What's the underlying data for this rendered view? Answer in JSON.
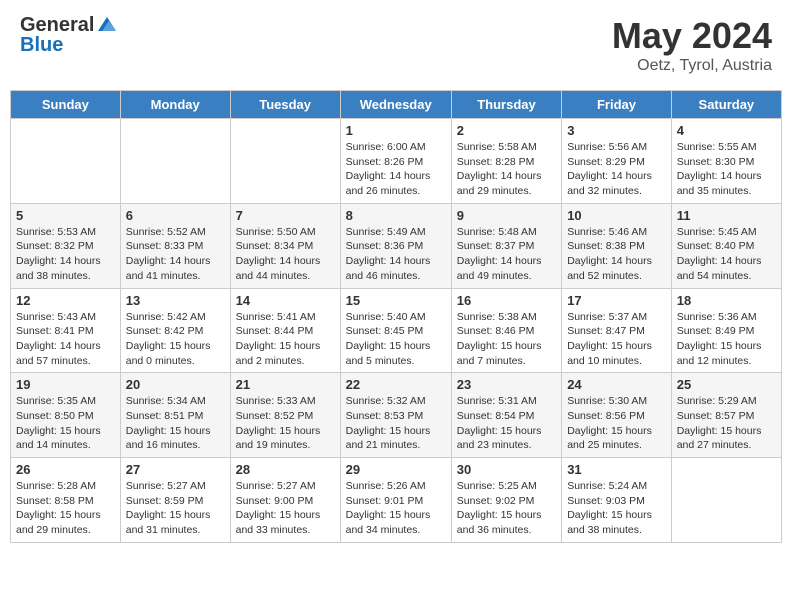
{
  "header": {
    "logo_general": "General",
    "logo_blue": "Blue",
    "month_year": "May 2024",
    "location": "Oetz, Tyrol, Austria"
  },
  "calendar": {
    "days_of_week": [
      "Sunday",
      "Monday",
      "Tuesday",
      "Wednesday",
      "Thursday",
      "Friday",
      "Saturday"
    ],
    "weeks": [
      [
        {
          "day": "",
          "info": ""
        },
        {
          "day": "",
          "info": ""
        },
        {
          "day": "",
          "info": ""
        },
        {
          "day": "1",
          "info": "Sunrise: 6:00 AM\nSunset: 8:26 PM\nDaylight: 14 hours\nand 26 minutes."
        },
        {
          "day": "2",
          "info": "Sunrise: 5:58 AM\nSunset: 8:28 PM\nDaylight: 14 hours\nand 29 minutes."
        },
        {
          "day": "3",
          "info": "Sunrise: 5:56 AM\nSunset: 8:29 PM\nDaylight: 14 hours\nand 32 minutes."
        },
        {
          "day": "4",
          "info": "Sunrise: 5:55 AM\nSunset: 8:30 PM\nDaylight: 14 hours\nand 35 minutes."
        }
      ],
      [
        {
          "day": "5",
          "info": "Sunrise: 5:53 AM\nSunset: 8:32 PM\nDaylight: 14 hours\nand 38 minutes."
        },
        {
          "day": "6",
          "info": "Sunrise: 5:52 AM\nSunset: 8:33 PM\nDaylight: 14 hours\nand 41 minutes."
        },
        {
          "day": "7",
          "info": "Sunrise: 5:50 AM\nSunset: 8:34 PM\nDaylight: 14 hours\nand 44 minutes."
        },
        {
          "day": "8",
          "info": "Sunrise: 5:49 AM\nSunset: 8:36 PM\nDaylight: 14 hours\nand 46 minutes."
        },
        {
          "day": "9",
          "info": "Sunrise: 5:48 AM\nSunset: 8:37 PM\nDaylight: 14 hours\nand 49 minutes."
        },
        {
          "day": "10",
          "info": "Sunrise: 5:46 AM\nSunset: 8:38 PM\nDaylight: 14 hours\nand 52 minutes."
        },
        {
          "day": "11",
          "info": "Sunrise: 5:45 AM\nSunset: 8:40 PM\nDaylight: 14 hours\nand 54 minutes."
        }
      ],
      [
        {
          "day": "12",
          "info": "Sunrise: 5:43 AM\nSunset: 8:41 PM\nDaylight: 14 hours\nand 57 minutes."
        },
        {
          "day": "13",
          "info": "Sunrise: 5:42 AM\nSunset: 8:42 PM\nDaylight: 15 hours\nand 0 minutes."
        },
        {
          "day": "14",
          "info": "Sunrise: 5:41 AM\nSunset: 8:44 PM\nDaylight: 15 hours\nand 2 minutes."
        },
        {
          "day": "15",
          "info": "Sunrise: 5:40 AM\nSunset: 8:45 PM\nDaylight: 15 hours\nand 5 minutes."
        },
        {
          "day": "16",
          "info": "Sunrise: 5:38 AM\nSunset: 8:46 PM\nDaylight: 15 hours\nand 7 minutes."
        },
        {
          "day": "17",
          "info": "Sunrise: 5:37 AM\nSunset: 8:47 PM\nDaylight: 15 hours\nand 10 minutes."
        },
        {
          "day": "18",
          "info": "Sunrise: 5:36 AM\nSunset: 8:49 PM\nDaylight: 15 hours\nand 12 minutes."
        }
      ],
      [
        {
          "day": "19",
          "info": "Sunrise: 5:35 AM\nSunset: 8:50 PM\nDaylight: 15 hours\nand 14 minutes."
        },
        {
          "day": "20",
          "info": "Sunrise: 5:34 AM\nSunset: 8:51 PM\nDaylight: 15 hours\nand 16 minutes."
        },
        {
          "day": "21",
          "info": "Sunrise: 5:33 AM\nSunset: 8:52 PM\nDaylight: 15 hours\nand 19 minutes."
        },
        {
          "day": "22",
          "info": "Sunrise: 5:32 AM\nSunset: 8:53 PM\nDaylight: 15 hours\nand 21 minutes."
        },
        {
          "day": "23",
          "info": "Sunrise: 5:31 AM\nSunset: 8:54 PM\nDaylight: 15 hours\nand 23 minutes."
        },
        {
          "day": "24",
          "info": "Sunrise: 5:30 AM\nSunset: 8:56 PM\nDaylight: 15 hours\nand 25 minutes."
        },
        {
          "day": "25",
          "info": "Sunrise: 5:29 AM\nSunset: 8:57 PM\nDaylight: 15 hours\nand 27 minutes."
        }
      ],
      [
        {
          "day": "26",
          "info": "Sunrise: 5:28 AM\nSunset: 8:58 PM\nDaylight: 15 hours\nand 29 minutes."
        },
        {
          "day": "27",
          "info": "Sunrise: 5:27 AM\nSunset: 8:59 PM\nDaylight: 15 hours\nand 31 minutes."
        },
        {
          "day": "28",
          "info": "Sunrise: 5:27 AM\nSunset: 9:00 PM\nDaylight: 15 hours\nand 33 minutes."
        },
        {
          "day": "29",
          "info": "Sunrise: 5:26 AM\nSunset: 9:01 PM\nDaylight: 15 hours\nand 34 minutes."
        },
        {
          "day": "30",
          "info": "Sunrise: 5:25 AM\nSunset: 9:02 PM\nDaylight: 15 hours\nand 36 minutes."
        },
        {
          "day": "31",
          "info": "Sunrise: 5:24 AM\nSunset: 9:03 PM\nDaylight: 15 hours\nand 38 minutes."
        },
        {
          "day": "",
          "info": ""
        }
      ]
    ]
  }
}
